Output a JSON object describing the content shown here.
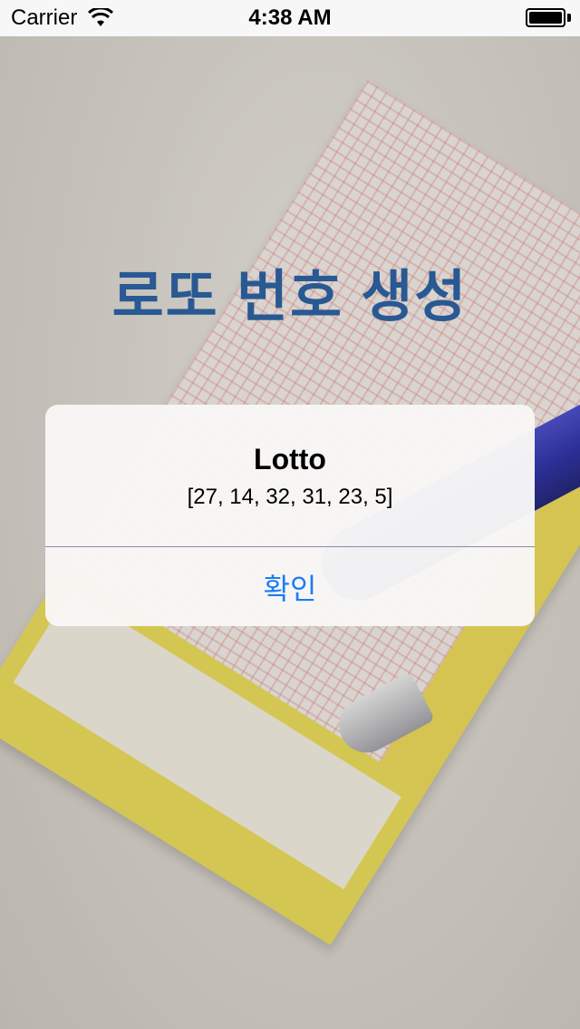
{
  "status_bar": {
    "carrier": "Carrier",
    "time": "4:38 AM",
    "icons": [
      "wifi-icon",
      "battery-icon"
    ]
  },
  "app": {
    "title": "로또 번호 생성",
    "title_color": "#17549b"
  },
  "alert": {
    "title": "Lotto",
    "message": "[27, 14, 32, 31, 23, 5]",
    "button_label": "확인",
    "button_color": "#1c7cf6"
  }
}
